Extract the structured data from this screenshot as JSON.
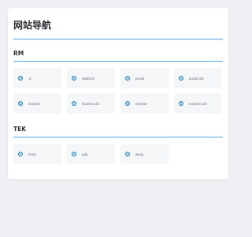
{
  "page": {
    "title": "网站导航"
  },
  "sections": [
    {
      "title": "RM",
      "items": [
        {
          "label": "oj"
        },
        {
          "label": "platform"
        },
        {
          "label": "portal"
        },
        {
          "label": "portal.old"
        },
        {
          "label": "student"
        },
        {
          "label": "student.old"
        },
        {
          "label": "teacher"
        },
        {
          "label": "teacher.old"
        }
      ]
    },
    {
      "title": "TEK",
      "items": [
        {
          "label": "mind"
        },
        {
          "label": "pda"
        },
        {
          "label": "wesy"
        }
      ]
    }
  ],
  "icons": {
    "item": "link-dot-icon"
  },
  "colors": {
    "accent": "#5aa3e6",
    "icon_ring": "#2c7fbf",
    "icon_fill": "#a9d6ef"
  }
}
